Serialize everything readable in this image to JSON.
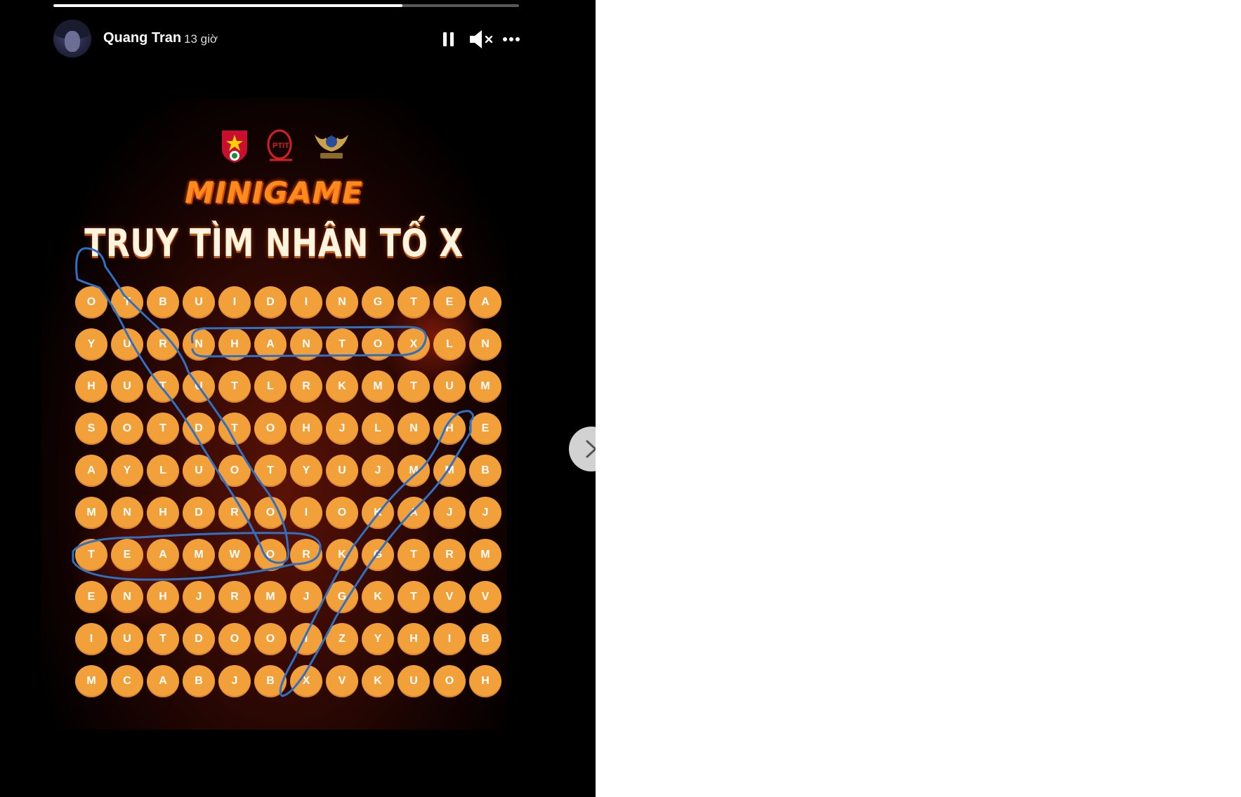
{
  "story": {
    "progress_fraction": 0.75,
    "author": {
      "name": "Quang Tran",
      "time": "13 giờ"
    },
    "controls": {
      "pause_icon": "pause-icon",
      "mute_icon": "speaker-muted-icon",
      "more_icon": "more-horizontal-icon"
    },
    "content": {
      "logos": [
        "youth-union-logo",
        "ptit-logo",
        "club-emblem-logo"
      ],
      "minigame_label": "MINIGAME",
      "title": "TRUY TÌM NHÂN TỐ X",
      "grid": [
        [
          "O",
          "T",
          "B",
          "U",
          "I",
          "D",
          "I",
          "N",
          "G",
          "T",
          "E",
          "A"
        ],
        [
          "Y",
          "U",
          "R",
          "N",
          "H",
          "A",
          "N",
          "T",
          "O",
          "X",
          "L",
          "N"
        ],
        [
          "H",
          "U",
          "T",
          "U",
          "T",
          "L",
          "R",
          "K",
          "M",
          "T",
          "U",
          "M"
        ],
        [
          "S",
          "O",
          "T",
          "D",
          "T",
          "O",
          "H",
          "J",
          "L",
          "N",
          "H",
          "E"
        ],
        [
          "A",
          "Y",
          "L",
          "U",
          "O",
          "T",
          "Y",
          "U",
          "J",
          "M",
          "M",
          "B"
        ],
        [
          "M",
          "N",
          "H",
          "D",
          "R",
          "O",
          "I",
          "O",
          "K",
          "A",
          "J",
          "J"
        ],
        [
          "T",
          "E",
          "A",
          "M",
          "W",
          "O",
          "R",
          "K",
          "G",
          "T",
          "R",
          "M"
        ],
        [
          "E",
          "N",
          "H",
          "J",
          "R",
          "M",
          "J",
          "G",
          "K",
          "T",
          "V",
          "V"
        ],
        [
          "I",
          "U",
          "T",
          "D",
          "O",
          "O",
          "I",
          "Z",
          "Y",
          "H",
          "I",
          "B"
        ],
        [
          "M",
          "C",
          "A",
          "B",
          "J",
          "B",
          "X",
          "V",
          "K",
          "U",
          "O",
          "H"
        ]
      ],
      "annotation_color": "#2f6fc4"
    },
    "next_icon": "chevron-right-icon"
  }
}
